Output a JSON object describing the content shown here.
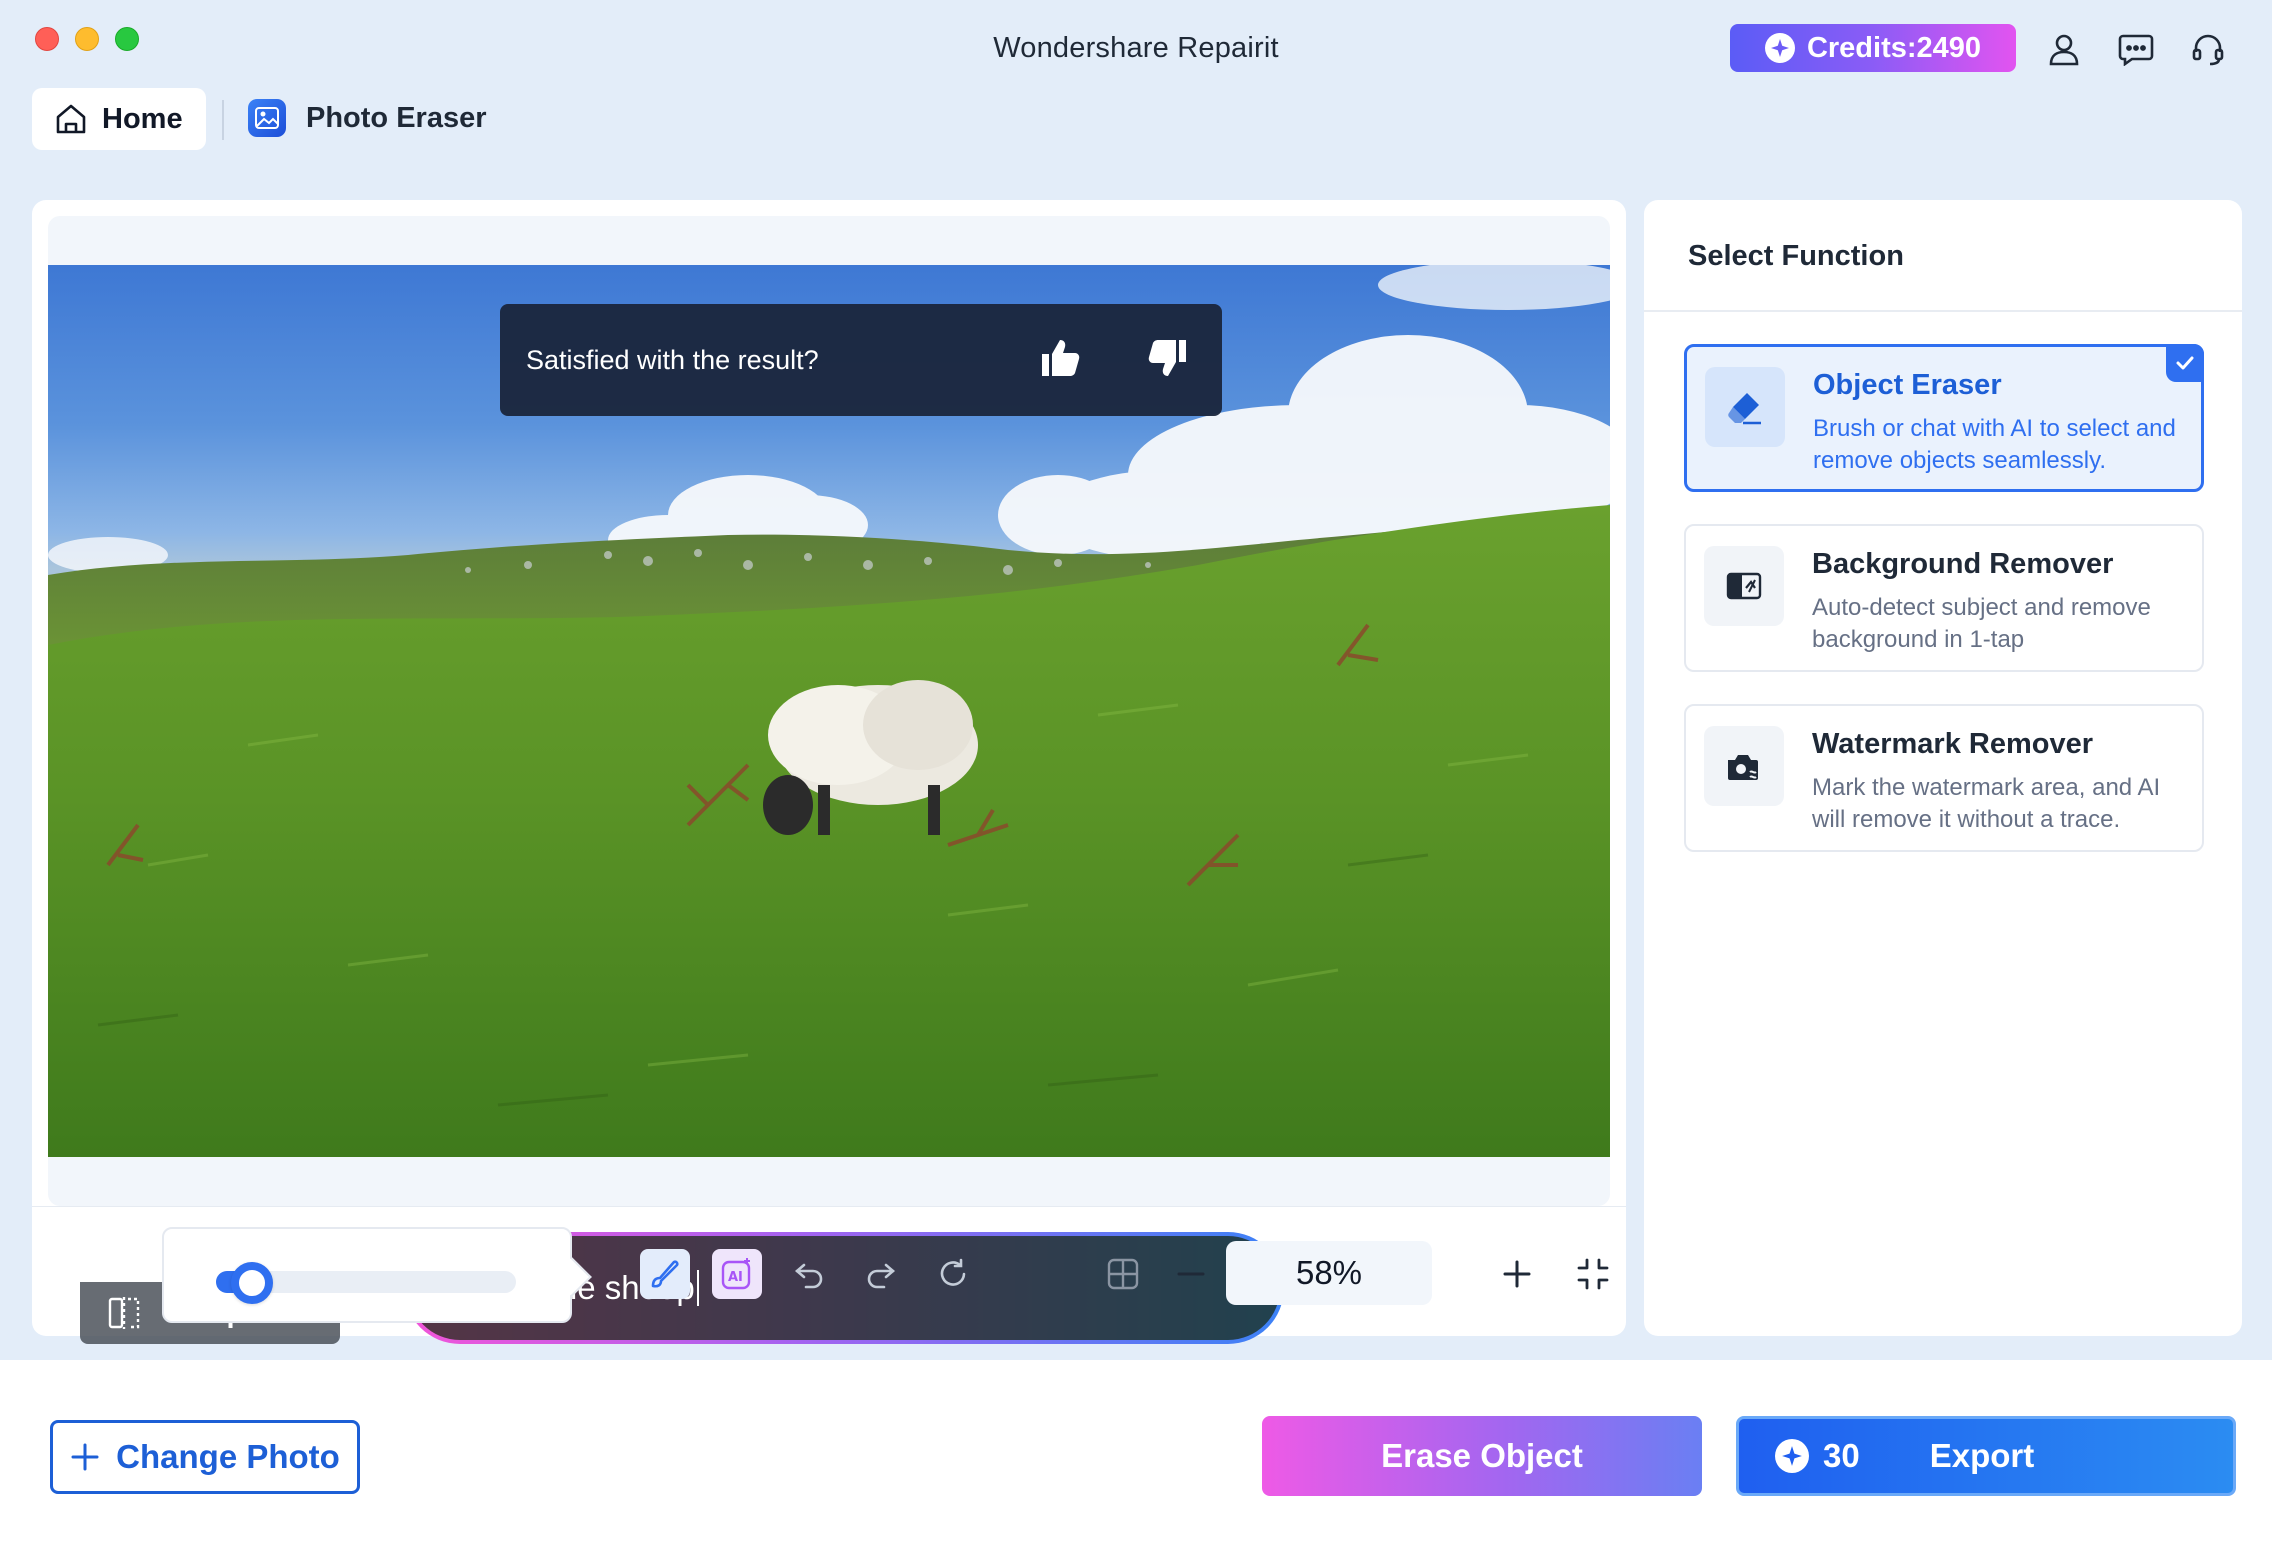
{
  "window": {
    "title": "Wondershare Repairit"
  },
  "header": {
    "credits_label": "Credits:2490",
    "icons": [
      "user-icon",
      "chat-icon",
      "headset-icon"
    ]
  },
  "nav": {
    "home_label": "Home",
    "current_label": "Photo Eraser"
  },
  "canvas": {
    "feedback_question": "Satisfied with the result?",
    "prompt_text": "erase the sheep",
    "compare_label": "Compare"
  },
  "toolbar": {
    "brush_size_fraction": 0.12,
    "zoom_label": "58%"
  },
  "functions": {
    "title": "Select Function",
    "items": [
      {
        "name": "Object Eraser",
        "description": "Brush or chat with AI to select and remove objects seamlessly.",
        "selected": true
      },
      {
        "name": "Background Remover",
        "description": "Auto-detect subject and remove background in 1-tap",
        "selected": false
      },
      {
        "name": "Watermark Remover",
        "description": "Mark the watermark area, and AI will remove it without a trace.",
        "selected": false
      }
    ]
  },
  "bottom": {
    "change_photo_label": "Change Photo",
    "erase_label": "Erase Object",
    "export_cost": "30",
    "export_label": "Export"
  },
  "colors": {
    "accent": "#2f6ff0",
    "background": "#e3edf9",
    "erase_gradient_start": "#ee5ae6",
    "export_gradient_start": "#1f5ff0"
  }
}
